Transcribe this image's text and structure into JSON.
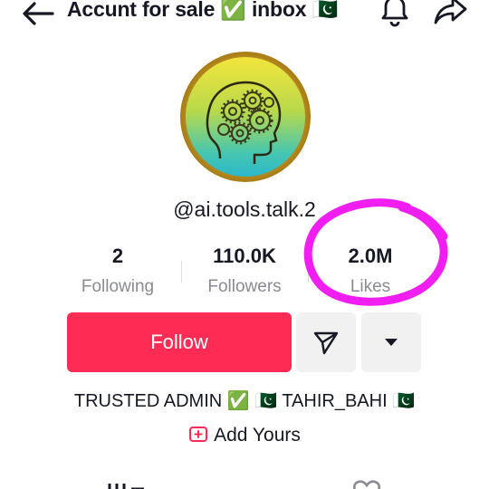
{
  "header": {
    "title": "Accunt for sale ✅ inbox 🇵🇰",
    "back_icon": "back-arrow-icon",
    "bell_icon": "bell-icon",
    "share_icon": "share-icon"
  },
  "profile": {
    "avatar_icon": "head-gears-avatar",
    "username": "@ai.tools.talk.2"
  },
  "stats": [
    {
      "value": "2",
      "label": "Following"
    },
    {
      "value": "110.0K",
      "label": "Followers"
    },
    {
      "value": "2.0M",
      "label": "Likes"
    }
  ],
  "actions": {
    "follow_label": "Follow",
    "message_icon": "send-icon",
    "more_icon": "caret-down-icon"
  },
  "bio": "TRUSTED ADMIN ✅ 🇵🇰 TAHIR_BAHI 🇵🇰",
  "add_yours": "Add Yours",
  "colors": {
    "follow": "#fe2c55",
    "highlight_circle": "#f01ef0",
    "secondary_button": "#f1f1f2",
    "label_gray": "#8a8b91"
  }
}
